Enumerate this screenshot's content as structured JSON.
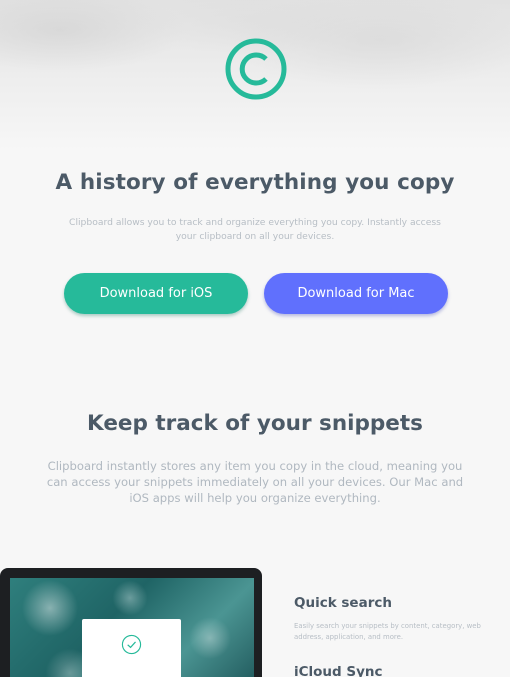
{
  "hero": {
    "title": "A history of everything you copy",
    "description": "Clipboard allows you to track and organize everything you copy. Instantly access your clipboard on all your devices.",
    "buttons": {
      "ios": "Download for iOS",
      "mac": "Download for Mac"
    }
  },
  "snippets": {
    "title": "Keep track of your snippets",
    "description": "Clipboard instantly stores any item you copy in the cloud, meaning you can access your snippets immediately on all your devices. Our Mac and iOS apps will help you organize everything."
  },
  "features": [
    {
      "title": "Quick search",
      "description": "Easily search your snippets by content, category, web address, application, and more."
    },
    {
      "title": "iCloud Sync",
      "description": ""
    }
  ],
  "colors": {
    "accent_green": "#26ba9a",
    "accent_blue": "#6070fd",
    "heading": "#4c5a67",
    "muted_text": "#b7bec5"
  },
  "icons": {
    "logo": "copyright-c-logo-icon",
    "check": "check-circle-icon"
  }
}
